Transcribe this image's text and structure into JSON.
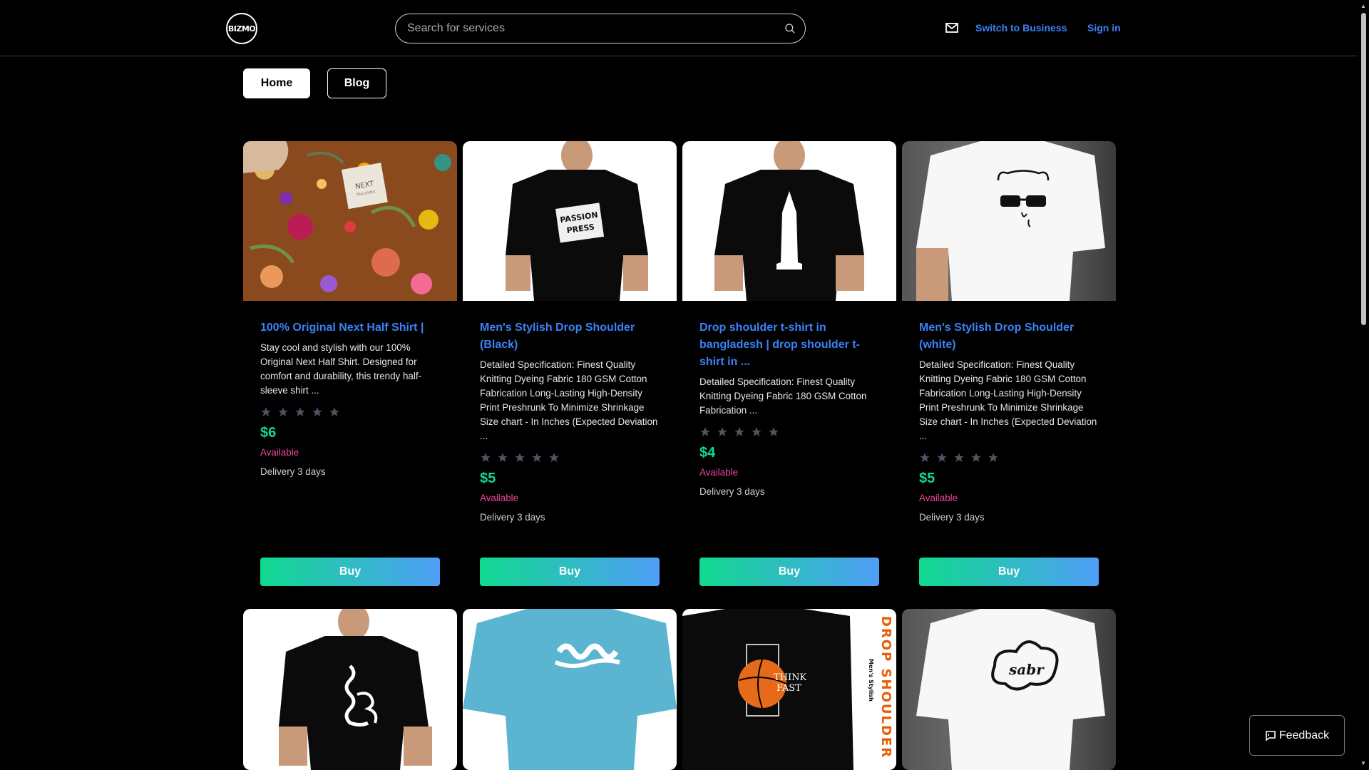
{
  "header": {
    "logo_text": "BIZMO",
    "search_placeholder": "Search for services",
    "switch_label": "Switch to Business",
    "signin_label": "Sign in"
  },
  "nav": {
    "home_label": "Home",
    "blog_label": "Blog"
  },
  "products": [
    {
      "title": "100% Original Next Half Shirt |",
      "description": "Stay cool and stylish with our 100% Original Next Half Shirt. Designed for comfort and durability, this trendy half-sleeve shirt ...",
      "rating": 0,
      "price": "$6",
      "availability": "Available",
      "delivery": "Delivery 3 days",
      "buy_label": "Buy",
      "image": "floral-shirt-with-next-label"
    },
    {
      "title": "Men's Stylish Drop Shoulder (Black)",
      "description": "Detailed Specification: Finest Quality Knitting Dyeing Fabric 180 GSM Cotton Fabrication Long-Lasting High-Density Print Preshrunk To Minimize Shrinkage Size chart - In Inches (Expected Deviation ...",
      "rating": 0,
      "price": "$5",
      "availability": "Available",
      "delivery": "Delivery 3 days",
      "buy_label": "Buy",
      "image": "black-tshirt-passion-press-print",
      "image_text": "PASSION PRESS"
    },
    {
      "title": "Drop shoulder t-shirt in bangladesh | drop shoulder t-shirt in ...",
      "description": "Detailed Specification: Finest Quality Knitting Dyeing Fabric 180 GSM Cotton Fabrication ...",
      "rating": 0,
      "price": "$4",
      "availability": "Available",
      "delivery": "Delivery 3 days",
      "buy_label": "Buy",
      "image": "black-tshirt-tower-print"
    },
    {
      "title": "Men's Stylish Drop Shoulder (white)",
      "description": "Detailed Specification: Finest Quality Knitting Dyeing Fabric 180 GSM Cotton Fabrication Long-Lasting High-Density Print Preshrunk To Minimize Shrinkage Size chart - In Inches (Expected Deviation ...",
      "rating": 0,
      "price": "$5",
      "availability": "Available",
      "delivery": "Delivery 3 days",
      "buy_label": "Buy",
      "image": "white-tshirt-bear-sunglasses-print"
    }
  ],
  "products_row2": [
    {
      "image": "black-tshirt-bengali-calligraphy-print"
    },
    {
      "image": "blue-tshirt-white-calligraphy-print"
    },
    {
      "image": "black-tshirt-think-fast-basketball-print",
      "image_text_1": "THINK",
      "image_text_2": "FAST",
      "side_text": "DROP SHOULDER",
      "side_sub": "Men's Stylish"
    },
    {
      "image": "white-tshirt-sabr-print"
    }
  ],
  "feedback_label": "Feedback",
  "colors": {
    "accent_blue": "#3b82f6",
    "price_green": "#10d98e",
    "available_pink": "#ec4899",
    "buy_gradient_start": "#10d98e",
    "buy_gradient_end": "#4f9ef8",
    "star_gray": "#4b5563"
  }
}
